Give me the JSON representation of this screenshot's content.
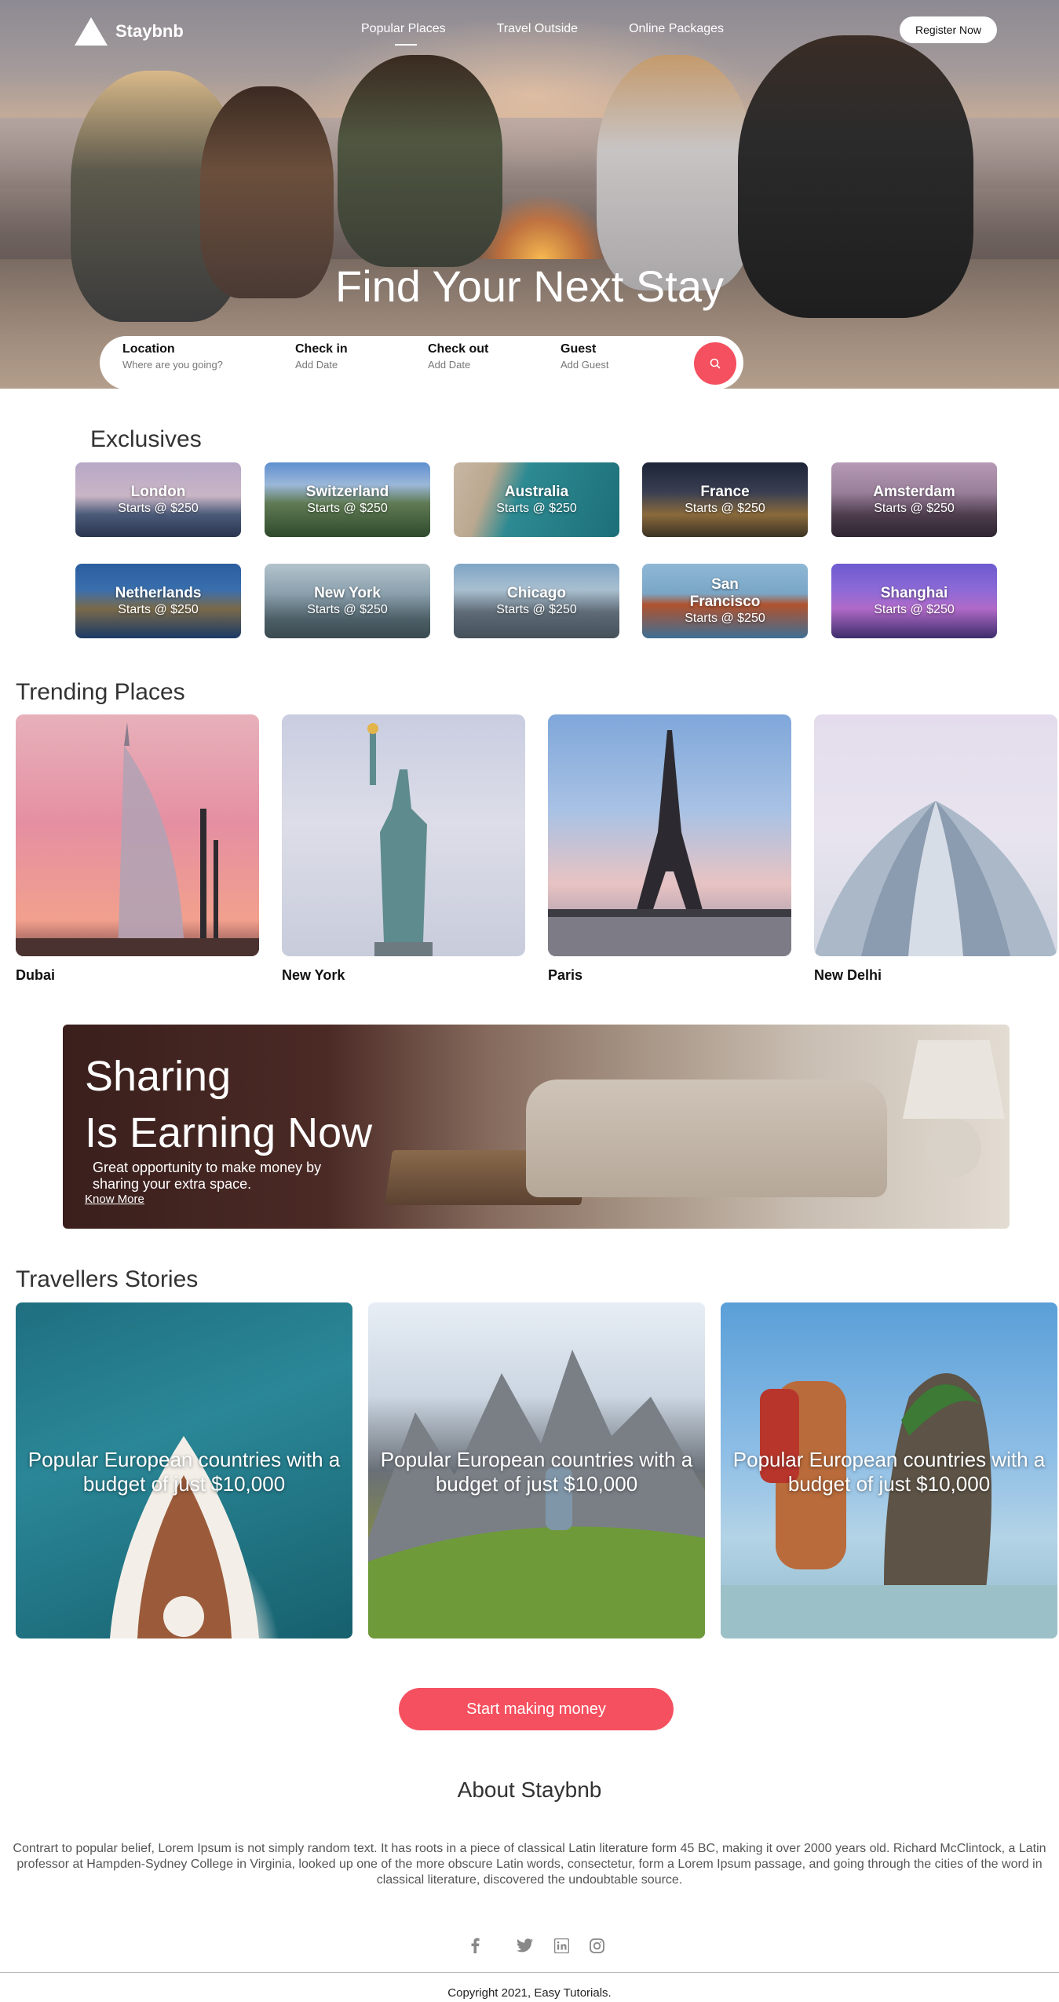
{
  "nav": {
    "brand": "Staybnb",
    "links": [
      "Popular Places",
      "Travel Outside",
      "Online Packages"
    ],
    "register_label": "Register Now"
  },
  "hero": {
    "title": "Find Your Next Stay",
    "fields": [
      {
        "label": "Location",
        "placeholder": "Where are you going?"
      },
      {
        "label": "Check in",
        "placeholder": "Add Date"
      },
      {
        "label": "Check out",
        "placeholder": "Add Date"
      },
      {
        "label": "Guest",
        "placeholder": "Add Guest"
      }
    ]
  },
  "exclusives": {
    "title": "Exclusives",
    "items": [
      {
        "name": "London",
        "price": "Starts @ $250"
      },
      {
        "name": "Switzerland",
        "price": "Starts @ $250"
      },
      {
        "name": "Australia",
        "price": "Starts @ $250"
      },
      {
        "name": "France",
        "price": "Starts @ $250"
      },
      {
        "name": "Amsterdam",
        "price": "Starts @ $250"
      },
      {
        "name": "Netherlands",
        "price": "Starts @ $250"
      },
      {
        "name": "New York",
        "price": "Starts @ $250"
      },
      {
        "name": "Chicago",
        "price": "Starts @ $250"
      },
      {
        "name": "San Francisco",
        "price": "Starts @ $250"
      },
      {
        "name": "Shanghai",
        "price": "Starts @ $250"
      }
    ]
  },
  "trending": {
    "title": "Trending Places",
    "items": [
      {
        "name": "Dubai"
      },
      {
        "name": "New York"
      },
      {
        "name": "Paris"
      },
      {
        "name": "New Delhi"
      }
    ]
  },
  "sharing": {
    "title_line1": "Sharing",
    "title_line2": "Is Earning Now",
    "text": "Great opportunity to make money by sharing your extra space.",
    "link": "Know More"
  },
  "stories": {
    "title": "Travellers Stories",
    "items": [
      {
        "text": "Popular European countries with a budget of just $10,000"
      },
      {
        "text": "Popular European countries with a budget of just $10,000"
      },
      {
        "text": "Popular European countries with a budget of just $10,000"
      }
    ]
  },
  "cta_label": "Start making money",
  "about": {
    "title": "About Staybnb",
    "text": "Contrart to popular belief, Lorem Ipsum is not simply random text. It has roots in a piece of classical Latin literature form 45 BC, making it over 2000 years old. Richard McClintock, a Latin professor at Hampden-Sydney College in Virginia, looked up one of the more obscure Latin words, consectetur, form a Lorem Ipsum passage, and going through the cities of the word in classical literature, discovered the undoubtable source."
  },
  "footer": {
    "social_icons": [
      "facebook-icon",
      "twitter-icon",
      "linkedin-icon",
      "instagram-icon"
    ],
    "copyright": "Copyright 2021, Easy Tutorials."
  },
  "colors": {
    "accent": "#f5505f"
  }
}
